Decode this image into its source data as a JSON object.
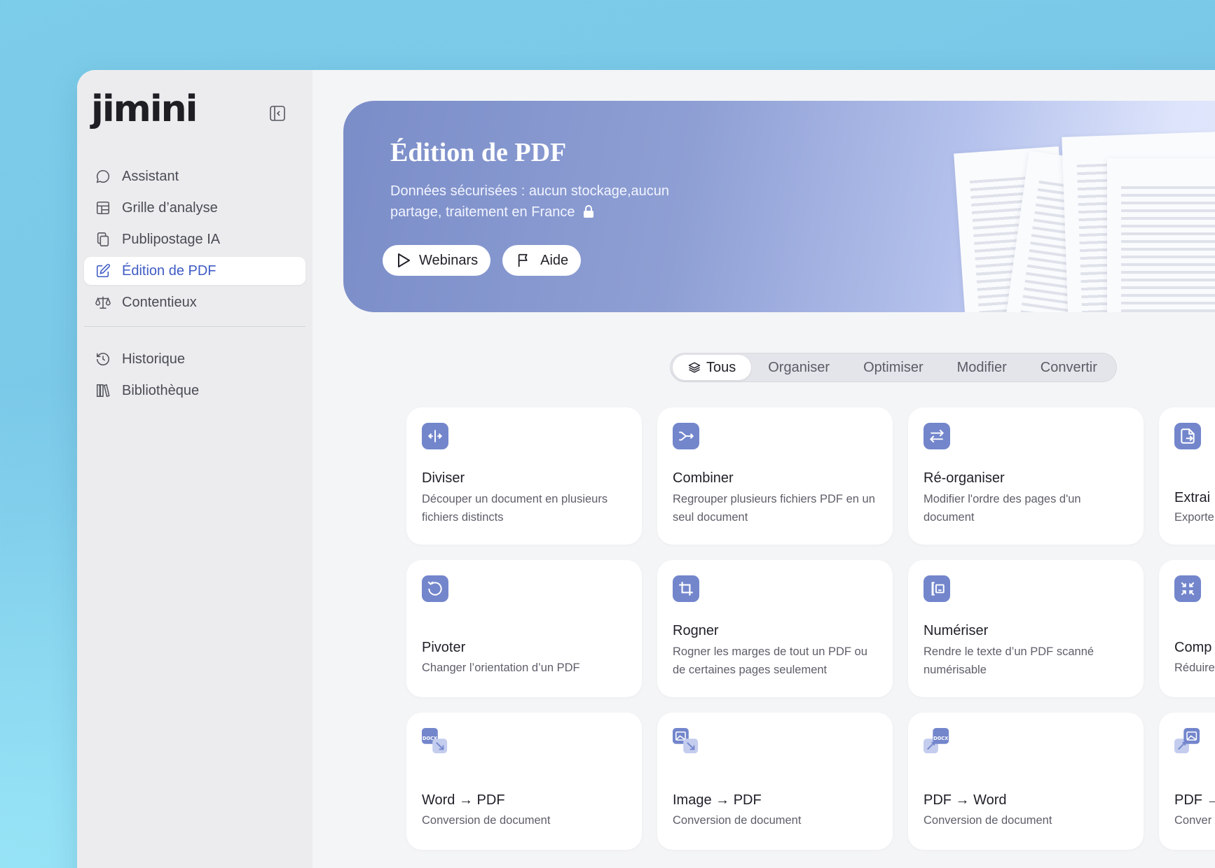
{
  "app": {
    "logo": "jimini"
  },
  "sidebar": {
    "items": [
      {
        "label": "Assistant",
        "icon": "chat-bubble-icon",
        "active": false
      },
      {
        "label": "Grille d’analyse",
        "icon": "table-grid-icon",
        "active": false
      },
      {
        "label": "Publipostage IA",
        "icon": "copy-documents-icon",
        "active": false
      },
      {
        "label": "Édition de PDF",
        "icon": "edit-pencil-icon",
        "active": true
      },
      {
        "label": "Contentieux",
        "icon": "scales-icon",
        "active": false
      }
    ],
    "secondary": [
      {
        "label": "Historique",
        "icon": "history-clock-icon"
      },
      {
        "label": "Bibliothèque",
        "icon": "library-books-icon"
      }
    ]
  },
  "hero": {
    "title": "Édition de PDF",
    "subtitle": "Données sécurisées : aucun stockage,aucun partage, traitement en France",
    "buttons": {
      "webinars": "Webinars",
      "aide": "Aide"
    }
  },
  "filters": {
    "tabs": [
      "Tous",
      "Organiser",
      "Optimiser",
      "Modifier",
      "Convertir"
    ],
    "active": "Tous"
  },
  "cards": [
    {
      "title": "Diviser",
      "desc": "Découper un document en plusieurs fichiers distincts",
      "icon": "split-icon"
    },
    {
      "title": "Combiner",
      "desc": "Regrouper plusieurs fichiers PDF en un seul document",
      "icon": "merge-icon"
    },
    {
      "title": "Ré-organiser",
      "desc": "Modifier l'ordre des pages d'un document",
      "icon": "reorder-arrows-icon"
    },
    {
      "title": "Extrai",
      "desc": "Exporte",
      "icon": "extract-file-icon"
    },
    {
      "title": "Pivoter",
      "desc": "Changer l’orientation d’un PDF",
      "icon": "rotate-icon"
    },
    {
      "title": "Rogner",
      "desc": "Rogner les marges de tout un PDF ou de certaines pages seulement",
      "icon": "crop-icon"
    },
    {
      "title": "Numériser",
      "desc": "Rendre le texte d’un PDF scanné numérisable",
      "icon": "ocr-scan-icon"
    },
    {
      "title": "Comp",
      "desc": "Réduire",
      "icon": "compress-icon"
    },
    {
      "title": "Word → PDF",
      "desc": "Conversion de document",
      "icon": "docx-to-pdf-icon"
    },
    {
      "title": "Image → PDF",
      "desc": "Conversion de document",
      "icon": "image-to-pdf-icon"
    },
    {
      "title": "PDF → Word",
      "desc": "Conversion de document",
      "icon": "pdf-to-docx-icon"
    },
    {
      "title": "PDF →",
      "desc": "Conver",
      "icon": "pdf-to-image-icon"
    }
  ],
  "colors": {
    "accent": "#3f5bc4",
    "icon_bg": "#7386cc"
  }
}
